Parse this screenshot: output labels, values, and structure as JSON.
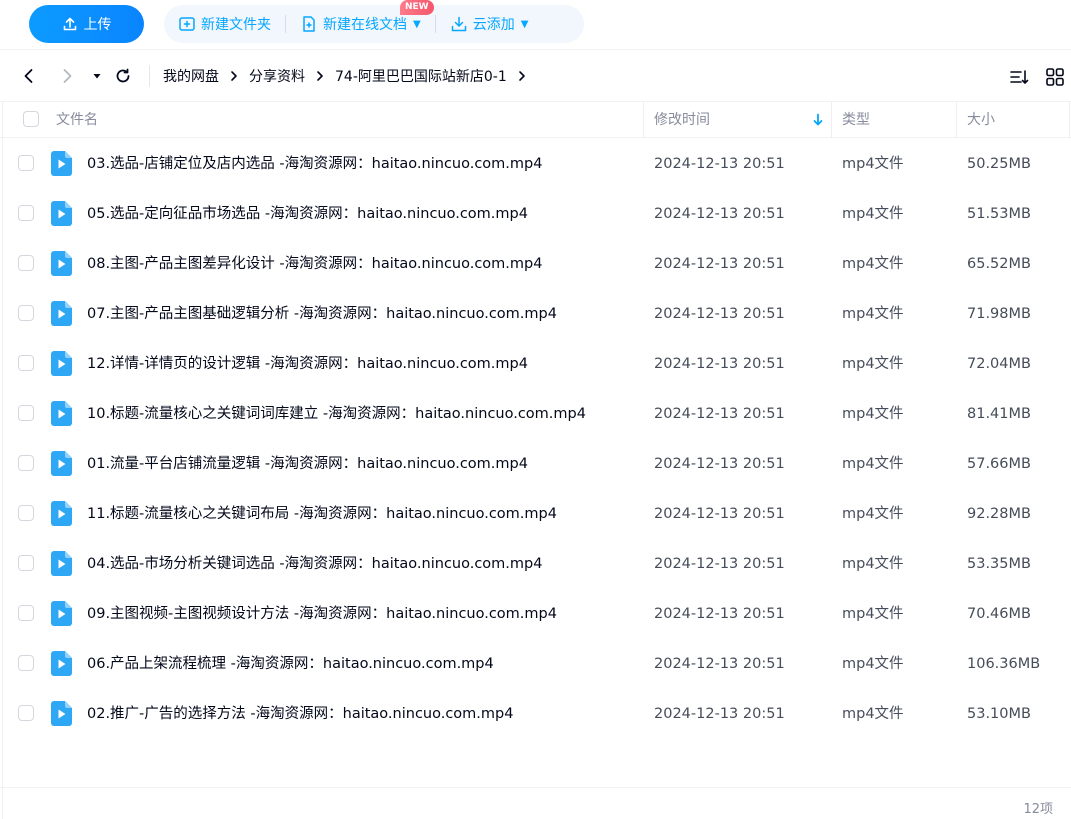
{
  "toolbar": {
    "upload_label": "上传",
    "new_folder_label": "新建文件夹",
    "new_online_doc_label": "新建在线文档",
    "new_badge": "NEW",
    "cloud_add_label": "云添加",
    "accent_color": "#06a7ff"
  },
  "nav": {
    "breadcrumb": [
      "我的网盘",
      "分享资料",
      "74-阿里巴巴国际站新店0-1"
    ]
  },
  "table": {
    "columns": {
      "name": "文件名",
      "modified": "修改时间",
      "type": "类型",
      "size": "大小"
    },
    "sort": {
      "column": "modified",
      "direction": "descending"
    },
    "rows": [
      {
        "name": "03.选品-店铺定位及店内选品 -海淘资源网：haitao.nincuo.com.mp4",
        "modified": "2024-12-13 20:51",
        "type": "mp4文件",
        "size": "50.25MB",
        "icon": "video-file-icon"
      },
      {
        "name": "05.选品-定向征品市场选品 -海淘资源网：haitao.nincuo.com.mp4",
        "modified": "2024-12-13 20:51",
        "type": "mp4文件",
        "size": "51.53MB",
        "icon": "video-file-icon"
      },
      {
        "name": "08.主图-产品主图差异化设计 -海淘资源网：haitao.nincuo.com.mp4",
        "modified": "2024-12-13 20:51",
        "type": "mp4文件",
        "size": "65.52MB",
        "icon": "video-file-icon"
      },
      {
        "name": "07.主图-产品主图基础逻辑分析 -海淘资源网：haitao.nincuo.com.mp4",
        "modified": "2024-12-13 20:51",
        "type": "mp4文件",
        "size": "71.98MB",
        "icon": "video-file-icon"
      },
      {
        "name": "12.详情-详情页的设计逻辑 -海淘资源网：haitao.nincuo.com.mp4",
        "modified": "2024-12-13 20:51",
        "type": "mp4文件",
        "size": "72.04MB",
        "icon": "video-file-icon"
      },
      {
        "name": "10.标题-流量核心之关键词词库建立 -海淘资源网：haitao.nincuo.com.mp4",
        "modified": "2024-12-13 20:51",
        "type": "mp4文件",
        "size": "81.41MB",
        "icon": "video-file-icon"
      },
      {
        "name": "01.流量-平台店铺流量逻辑 -海淘资源网：haitao.nincuo.com.mp4",
        "modified": "2024-12-13 20:51",
        "type": "mp4文件",
        "size": "57.66MB",
        "icon": "video-file-icon"
      },
      {
        "name": "11.标题-流量核心之关键词布局 -海淘资源网：haitao.nincuo.com.mp4",
        "modified": "2024-12-13 20:51",
        "type": "mp4文件",
        "size": "92.28MB",
        "icon": "video-file-icon"
      },
      {
        "name": "04.选品-市场分析关键词选品 -海淘资源网：haitao.nincuo.com.mp4",
        "modified": "2024-12-13 20:51",
        "type": "mp4文件",
        "size": "53.35MB",
        "icon": "video-file-icon"
      },
      {
        "name": "09.主图视频-主图视频设计方法 -海淘资源网：haitao.nincuo.com.mp4",
        "modified": "2024-12-13 20:51",
        "type": "mp4文件",
        "size": "70.46MB",
        "icon": "video-file-icon"
      },
      {
        "name": "06.产品上架流程梳理 -海淘资源网：haitao.nincuo.com.mp4",
        "modified": "2024-12-13 20:51",
        "type": "mp4文件",
        "size": "106.36MB",
        "icon": "video-file-icon"
      },
      {
        "name": "02.推广-广告的选择方法 -海淘资源网：haitao.nincuo.com.mp4",
        "modified": "2024-12-13 20:51",
        "type": "mp4文件",
        "size": "53.10MB",
        "icon": "video-file-icon"
      }
    ]
  },
  "footer": {
    "item_count": "12项"
  }
}
